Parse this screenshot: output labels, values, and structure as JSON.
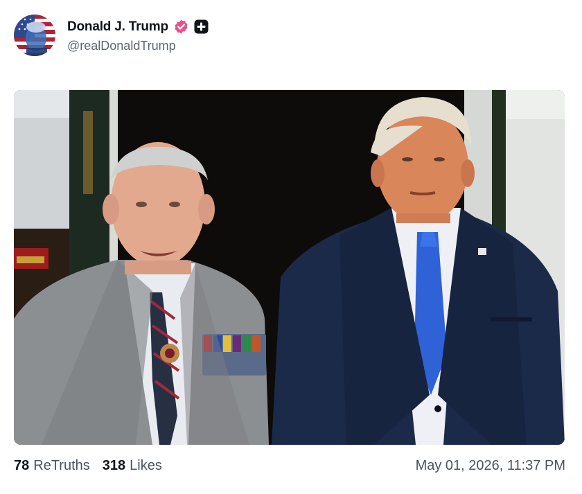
{
  "post": {
    "author": {
      "display_name": "Donald J. Trump",
      "handle": "@realDonaldTrump",
      "avatar_icon": "flag-portrait-avatar",
      "verified_icon": "verified-badge-icon",
      "verified_color": "#e8508a",
      "badge_icon": "plus-badge-icon"
    },
    "media": {
      "kind": "photo"
    },
    "stats": {
      "retruths_count": "78",
      "retruths_label": "ReTruths",
      "likes_count": "318",
      "likes_label": "Likes"
    },
    "timestamp": "May 01, 2026, 11:37 PM"
  }
}
